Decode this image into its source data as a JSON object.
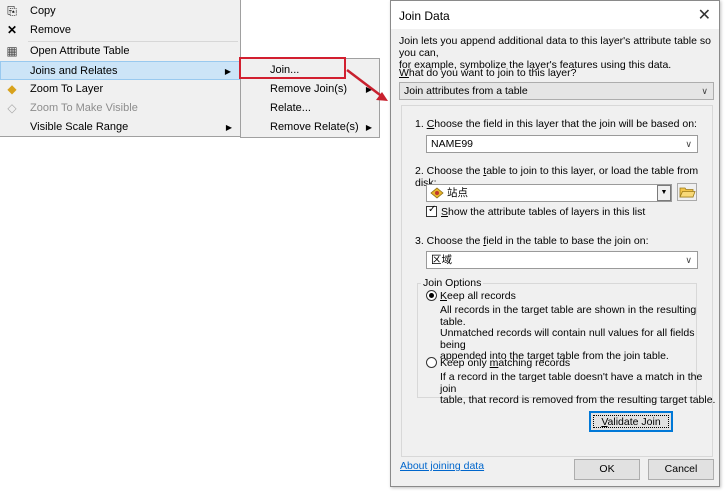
{
  "context_menu": {
    "items": [
      {
        "label": "Copy",
        "icon": "copy-icon",
        "glyph": "⎘"
      },
      {
        "label": "Remove",
        "icon": "remove-x-icon",
        "glyph": "✕"
      },
      {
        "label": "Open Attribute Table",
        "icon": "table-icon",
        "glyph": "▦"
      },
      {
        "label": "Joins and Relates"
      },
      {
        "label": "Zoom To Layer",
        "icon": "zoom-to-layer-icon",
        "glyph": "◆"
      },
      {
        "label": "Zoom To Make Visible",
        "icon": "zoom-visible-icon",
        "glyph": "◇"
      },
      {
        "label": "Visible Scale Range"
      }
    ],
    "arrow": "▶"
  },
  "submenu": {
    "items": [
      {
        "label": "Join..."
      },
      {
        "label": "Remove Join(s)"
      },
      {
        "label": "Relate..."
      },
      {
        "label": "Remove Relate(s)"
      }
    ],
    "highlight_color": "#d21f2f"
  },
  "dialog": {
    "title": "Join Data",
    "close_glyph": "✕",
    "intro_line1": "Join lets you append additional data to this layer's attribute table so you can,",
    "intro_line2": "for example, symbolize the layer's features using this data.",
    "question_accel": "W",
    "question_rest": "hat do you want to join to this layer?",
    "join_type_value": "Join attributes from a table",
    "step1_pre": "1.  ",
    "step1_accel": "C",
    "step1_rest": "hoose the field in this layer that the join will be based on:",
    "step1_value": "NAME99",
    "step2_pre": "2.  Choose the ",
    "step2_accel": "t",
    "step2_rest": "able to join to this layer, or load the table from disk:",
    "step2_value": "站点",
    "show_tables_accel": "S",
    "show_tables_rest": "how the attribute tables of layers in this list",
    "step3_pre": "3.  Choose the ",
    "step3_accel": "f",
    "step3_rest": "ield in the table to base the join on:",
    "step3_value": "区域",
    "join_options_label": "Join Options",
    "keep_all_accel": "K",
    "keep_all_rest": "eep all records",
    "keep_all_desc": [
      "All records in the target table are shown in the resulting table.",
      "Unmatched records will contain null values for all fields being",
      "appended into the target table from the join table."
    ],
    "keep_matching_pre": "Keep only ",
    "keep_matching_accel": "m",
    "keep_matching_rest": "atching records",
    "keep_matching_desc": [
      "If a record in the target table doesn't have a match in the join",
      "table, that record is removed from the resulting target table."
    ],
    "validate_accel": "V",
    "validate_rest": "alidate Join",
    "about_link": "About joining data",
    "ok_label": "OK",
    "cancel_label": "Cancel",
    "chevron": "∨"
  }
}
